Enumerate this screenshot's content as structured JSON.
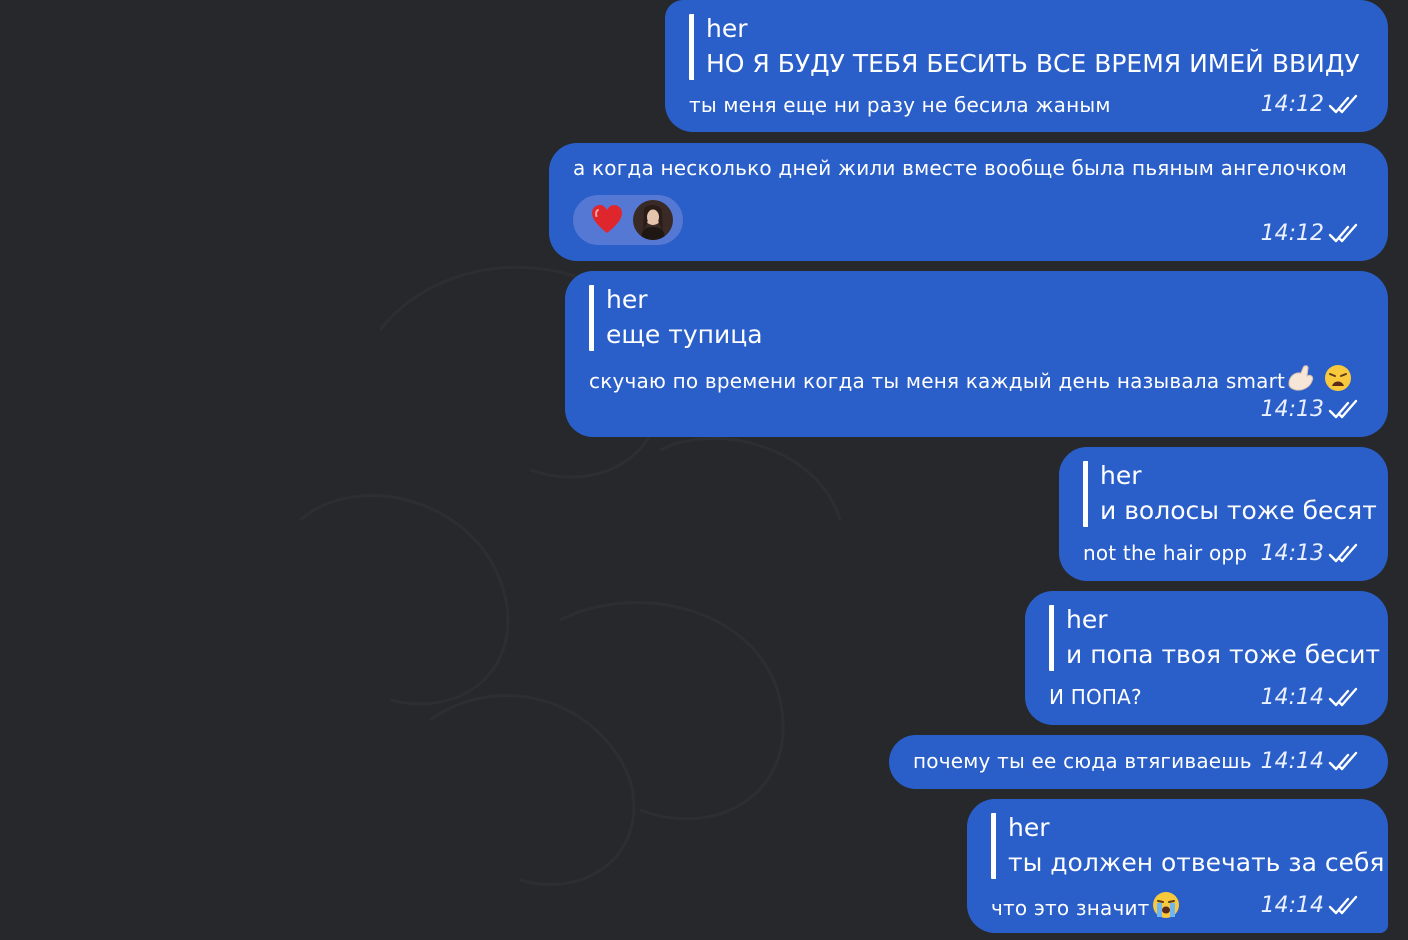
{
  "messages": [
    {
      "reply_author": "her",
      "reply_text": "НО Я БУДУ ТЕБЯ БЕСИТЬ ВСЕ ВРЕМЯ ИМЕЙ ВВИДУ",
      "text": "ты меня еще ни разу не бесила жаным",
      "time": "14:12"
    },
    {
      "text": "а когда несколько дней жили вместе вообще была пьяным ангелочком",
      "reactions": [
        "heart",
        "avatar"
      ],
      "time": "14:12"
    },
    {
      "reply_author": "her",
      "reply_text": "еще тупица",
      "text": "скучаю по времени когда ты меня каждый день называла smart",
      "emojis": [
        "pinching-hand",
        "weary-face"
      ],
      "time": "14:13"
    },
    {
      "reply_author": "her",
      "reply_text": "и волосы тоже бесят",
      "text": "not the hair opp",
      "time": "14:13"
    },
    {
      "reply_author": "her",
      "reply_text": "и попа твоя тоже бесит",
      "text": "И ПОПА?",
      "time": "14:14"
    },
    {
      "text": "почему ты ее сюда втягиваешь",
      "time": "14:14"
    },
    {
      "reply_author": "her",
      "reply_text": "ты должен отвечать за себя",
      "text": "что это значит",
      "emojis": [
        "loudly-crying-face"
      ],
      "time": "14:14"
    }
  ],
  "colors": {
    "background": "#26282b",
    "bubble": "#2a5fc9",
    "reaction_pill": "#5478d3",
    "text": "#ffffff"
  }
}
